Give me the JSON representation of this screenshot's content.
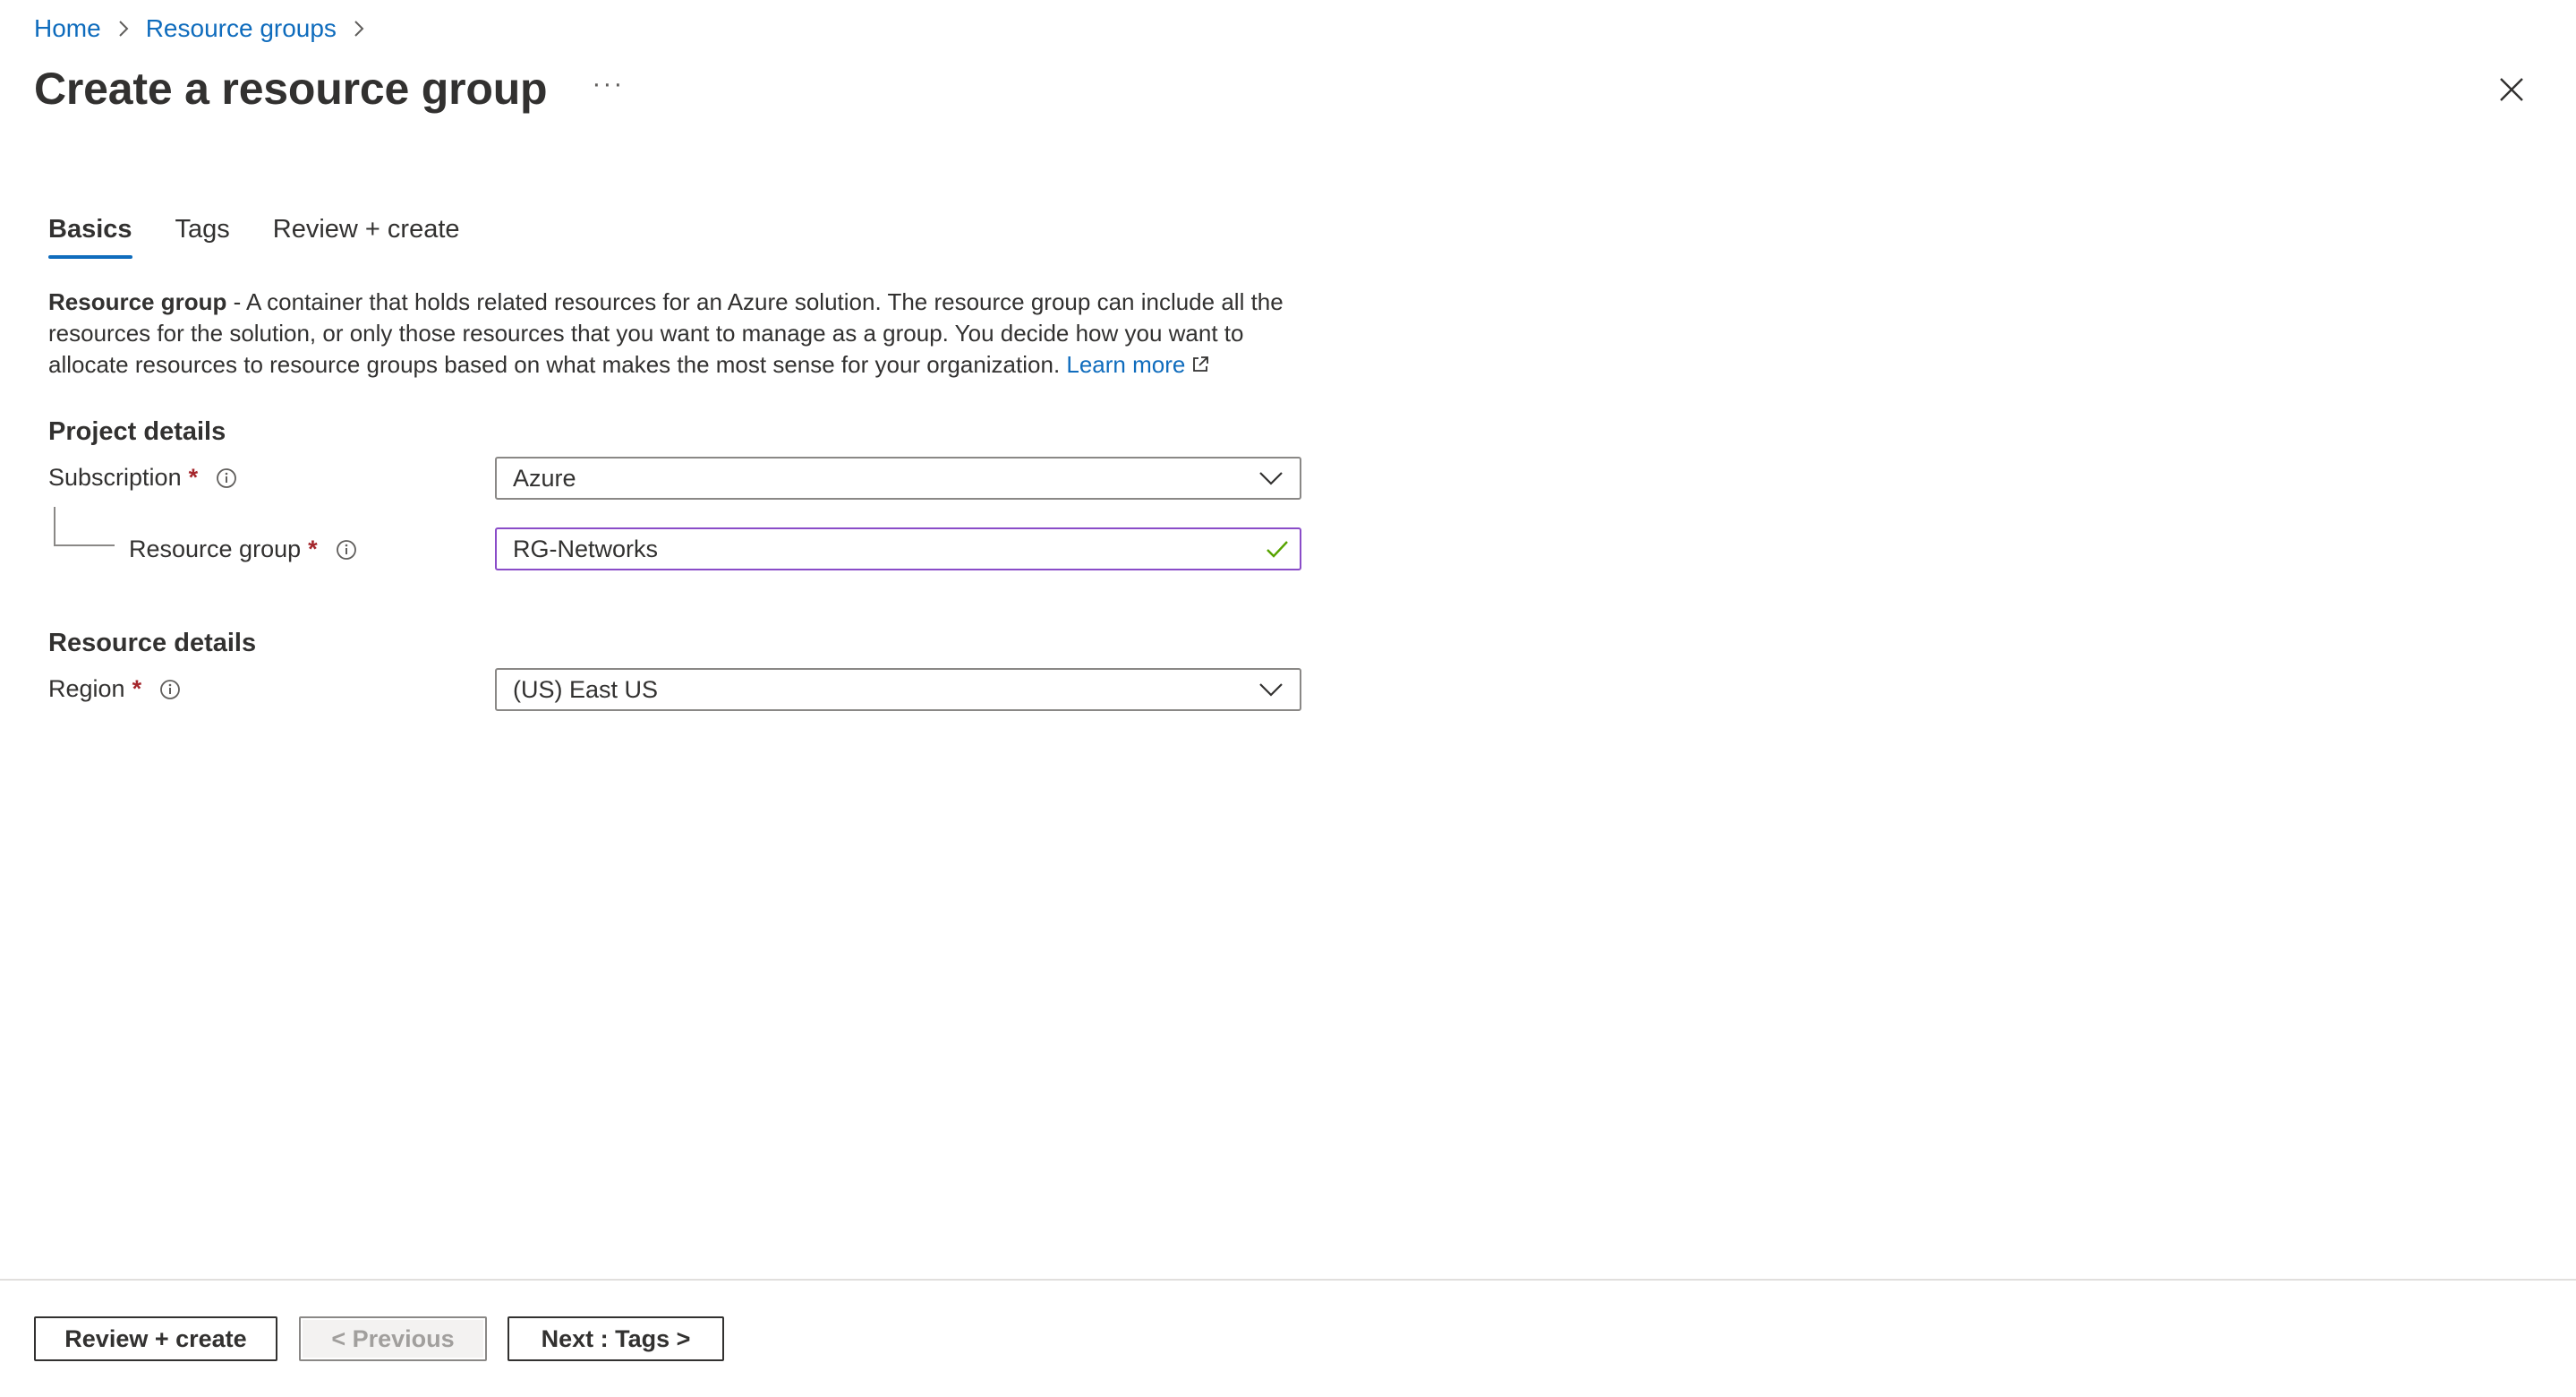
{
  "breadcrumb": {
    "items": [
      "Home",
      "Resource groups"
    ]
  },
  "header": {
    "title": "Create a resource group",
    "more_label": "···"
  },
  "tabs": [
    {
      "label": "Basics",
      "active": true
    },
    {
      "label": "Tags",
      "active": false
    },
    {
      "label": "Review + create",
      "active": false
    }
  ],
  "description": {
    "bold": "Resource group",
    "text": " - A container that holds related resources for an Azure solution. The resource group can include all the resources for the solution, or only those resources that you want to manage as a group. You decide how you want to allocate resources to resource groups based on what makes the most sense for your organization. ",
    "link": "Learn more"
  },
  "project_details": {
    "heading": "Project details",
    "subscription": {
      "label": "Subscription",
      "required": "*",
      "value": "Azure"
    },
    "resource_group": {
      "label": "Resource group",
      "required": "*",
      "value": "RG-Networks"
    }
  },
  "resource_details": {
    "heading": "Resource details",
    "region": {
      "label": "Region",
      "required": "*",
      "value": "(US) East US"
    }
  },
  "footer": {
    "review_create": "Review + create",
    "previous": "< Previous",
    "next": "Next : Tags >"
  },
  "colors": {
    "accent": "#0f6cbd",
    "focus_border": "#8a4cc8",
    "required": "#a4262c",
    "valid_check": "#57a300"
  }
}
